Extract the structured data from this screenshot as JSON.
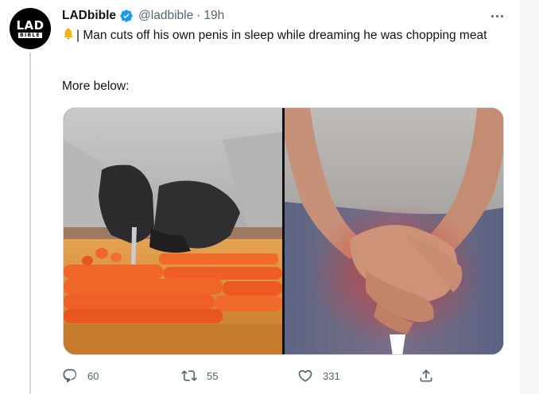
{
  "tweet": {
    "avatar": {
      "line1": "LAD",
      "line2": "BIBLE"
    },
    "display_name": "LADbible",
    "handle": "@ladbible",
    "separator": "·",
    "time": "19h",
    "text": "| Man cuts off his own penis in sleep while dreaming he was chopping meat",
    "more_below": "More below:",
    "emoji": "bell-icon"
  },
  "actions": {
    "replies": "60",
    "retweets": "55",
    "likes": "331"
  },
  "colors": {
    "verified": "#1d9bf0",
    "secondary_text": "#536471",
    "border": "#cfd9de"
  }
}
